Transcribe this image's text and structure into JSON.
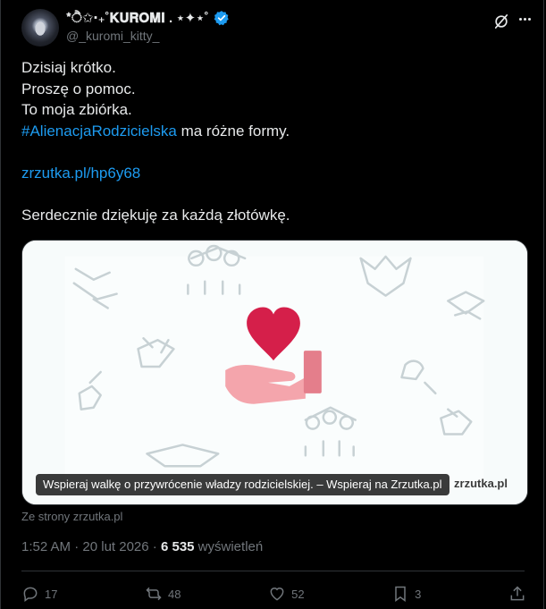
{
  "author": {
    "display_name": "*ੈ✩‧₊˚𝐊𝐔𝐑𝐎𝐌𝐈 .  ⋆✦⋆˚",
    "handle": "@_kuromi_kitty_",
    "verified": true,
    "verified_color": "#1d9bf0"
  },
  "tweet": {
    "lines": [
      "Dzisiaj krótko.",
      "Proszę o pomoc.",
      "To moja zbiórka."
    ],
    "hashtag": "#AlienacjaRodzicielska",
    "hashtag_rest": " ma różne formy.",
    "url": "zrzutka.pl/hp6y68",
    "closing": "Serdecznie dziękuję za każdą złotówkę."
  },
  "card": {
    "caption": "Wspieraj walkę o przywrócenie władzy rodzicielskiej. – Wspieraj na Zrzutka.pl",
    "brand": "zrzutka.pl",
    "source": "Ze strony zrzutka.pl",
    "heart_color": "#d51f4a",
    "hand_color": "#f4a5ac"
  },
  "meta": {
    "time": "1:52 AM",
    "separator1": " · ",
    "date": "20 lut 2026",
    "separator2": " · ",
    "views": "6 535",
    "views_label": " wyświetleń"
  },
  "actions": {
    "replies": "17",
    "reposts": "48",
    "likes": "52",
    "bookmarks": "3"
  },
  "colors": {
    "background": "#000000",
    "text": "#e7e9ea",
    "muted": "#71767b",
    "accent": "#1d9bf0",
    "border": "#2f3336"
  }
}
